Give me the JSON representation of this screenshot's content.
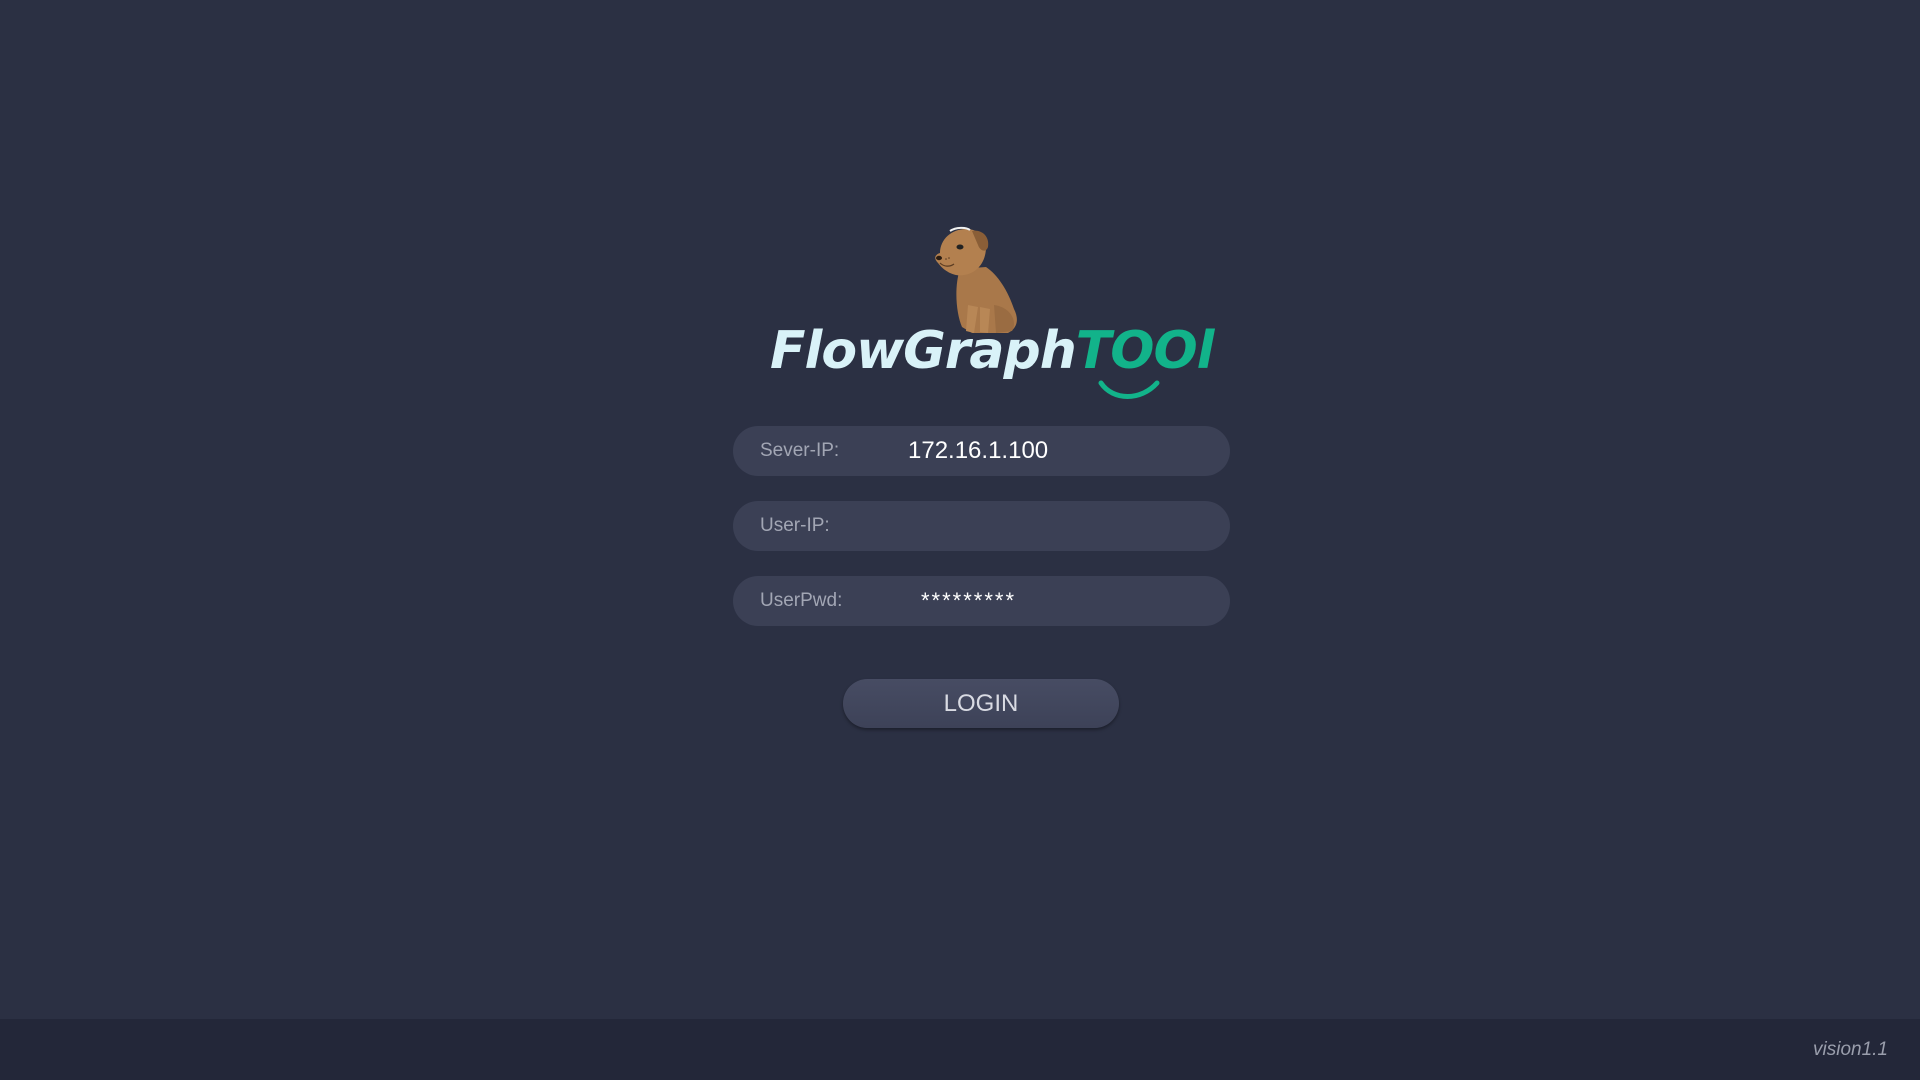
{
  "app": {
    "brand_part1": "FlowGraph",
    "brand_part2": "TOOl"
  },
  "login_form": {
    "server_ip": {
      "label": "Sever-IP:",
      "value": "172.16.1.100"
    },
    "user_ip": {
      "label": "User-IP:",
      "value": ""
    },
    "password": {
      "label": "UserPwd:",
      "value": "*********"
    },
    "login_label": "LOGIN"
  },
  "footer": {
    "version": "vision1.1"
  },
  "icons": {
    "mascot": "dog-mascot-icon",
    "smile": "smile-icon"
  },
  "colors": {
    "background": "#2b3043",
    "field": "#3b4055",
    "brand_light": "#d9f2f8",
    "brand_accent": "#12b38a",
    "footer": "#232739"
  }
}
